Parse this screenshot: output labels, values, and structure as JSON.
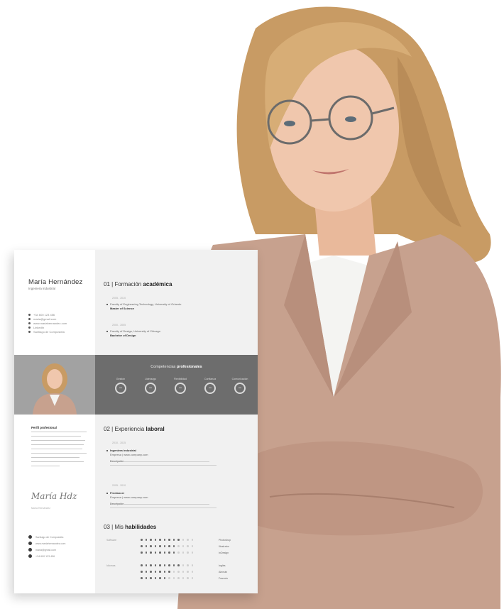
{
  "resume": {
    "name": "María Hernández",
    "job_title": "Ingeniera industrial",
    "contacts": [
      "+34 600 123 456",
      "maria@gmail.com",
      "www.mariahernandez.com",
      "LinkedIn",
      "Santiago de Compostela"
    ],
    "education": {
      "number": "01",
      "title_prefix": "Formación",
      "title_bold": "académica",
      "entries": [
        {
          "years": "2005 - 2010",
          "line1": "Faculty of Engineering Technology, University of Orlando",
          "line2": "Master of Science"
        },
        {
          "years": "2000 - 2005",
          "line1": "Faculty of Design, University of Chicago",
          "line2": "Bachelor of Design"
        }
      ]
    },
    "competencies": {
      "title_prefix": "Competencias",
      "title_bold": "profesionales",
      "items": [
        {
          "label": "Gestión"
        },
        {
          "label": "Liderazgo"
        },
        {
          "label": "Flexibilidad"
        },
        {
          "label": "Confianza"
        },
        {
          "label": "Comunicación"
        }
      ]
    },
    "profile_title": "Perfil profesional",
    "experience": {
      "number": "02",
      "title_prefix": "Experiencia",
      "title_bold": "laboral",
      "entries": [
        {
          "years": "2010 - 2015",
          "role": "Ingeniera industrial",
          "company": "Empresa | www.company.com",
          "desc_label": "Descripción"
        },
        {
          "years": "2005 - 2010",
          "role": "Freelancer",
          "company": "Empresa | www.company.com",
          "desc_label": "Descripción"
        }
      ]
    },
    "signature": "María Hdz",
    "signature_caption": "María Hernández",
    "skills": {
      "number": "03",
      "title_prefix": "Mis",
      "title_bold": "habilidades",
      "groups": [
        {
          "category": "Software",
          "items": [
            {
              "name": "Photoshop",
              "level": 9
            },
            {
              "name": "Illustrator",
              "level": 8
            },
            {
              "name": "InDesign",
              "level": 8
            }
          ]
        },
        {
          "category": "Idiomas",
          "items": [
            {
              "name": "Inglés",
              "level": 9
            },
            {
              "name": "Alemán",
              "level": 7
            },
            {
              "name": "Francés",
              "level": 6
            }
          ]
        }
      ]
    },
    "colors": {
      "band": "#6d6d6d",
      "right_column": "#f1f1f1",
      "text_dark": "#333333"
    }
  },
  "scene": {
    "jacket_color": "#c7a18e",
    "hair_color": "#c89b64",
    "blouse_color": "#f4f4f2",
    "skin_color": "#f0c7ad"
  }
}
